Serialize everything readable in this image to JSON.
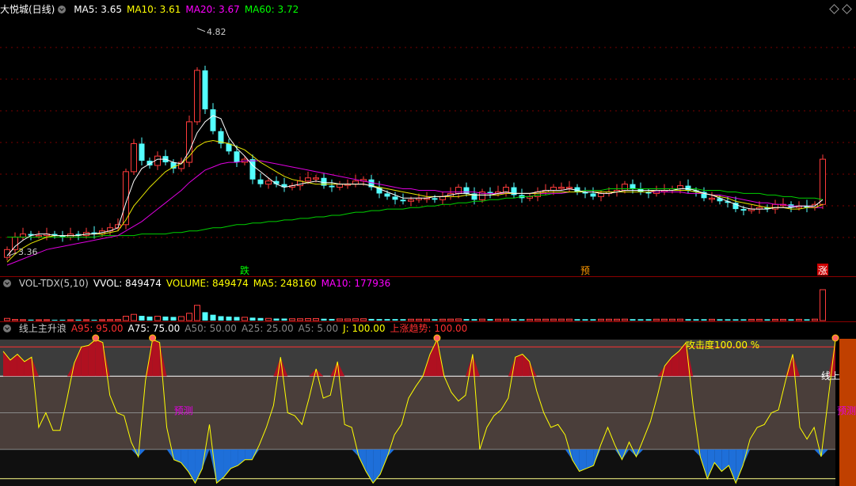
{
  "price_panel": {
    "title": "大悦城(日线)",
    "ma_items": [
      {
        "label": "MA5: 3.65",
        "color": "#ffffff"
      },
      {
        "label": "MA10: 3.61",
        "color": "#ffff00"
      },
      {
        "label": "MA20: 3.67",
        "color": "#ff00ff"
      },
      {
        "label": "MA60: 3.72",
        "color": "#00ff00"
      }
    ],
    "high_label": "4.82",
    "low_label": "3.36",
    "signals": [
      {
        "text": "跌",
        "color": "#00ff00"
      },
      {
        "text": "预",
        "color": "#ff9900"
      },
      {
        "text": "涨",
        "color": "#ffffff",
        "bg": "#cc0000"
      }
    ]
  },
  "volume_panel": {
    "items": [
      {
        "label": "VOL-TDX(5,10)",
        "color": "#cccccc"
      },
      {
        "label": "VVOL: 849474",
        "color": "#ffffff"
      },
      {
        "label": "VOLUME: 849474",
        "color": "#ffff00"
      },
      {
        "label": "MA5: 248160",
        "color": "#ffff00"
      },
      {
        "label": "MA10: 177936",
        "color": "#ff00ff"
      }
    ]
  },
  "indicator_panel": {
    "items": [
      {
        "label": "线上主升浪",
        "color": "#cccccc"
      },
      {
        "label": "A95: 95.00",
        "color": "#ff3030"
      },
      {
        "label": "A75: 75.00",
        "color": "#ffffff"
      },
      {
        "label": "A50: 50.00",
        "color": "#888888"
      },
      {
        "label": "A25: 25.00",
        "color": "#888888"
      },
      {
        "label": "A5: 5.00",
        "color": "#888888"
      },
      {
        "label": "J: 100.00",
        "color": "#ffff00"
      },
      {
        "label": "上涨趋势: 100.00",
        "color": "#ff3030"
      }
    ],
    "attack_label": "攻击度100.00 %",
    "side_label": "线上",
    "predict_label": "预测"
  },
  "chart_data": [
    {
      "type": "candlestick",
      "title": "大悦城(日线)",
      "annotations": {
        "max": 4.82,
        "min": 3.36
      },
      "ylim": [
        3.3,
        4.9
      ],
      "closes": [
        3.4,
        3.48,
        3.5,
        3.49,
        3.49,
        3.5,
        3.49,
        3.48,
        3.5,
        3.49,
        3.51,
        3.5,
        3.52,
        3.54,
        3.56,
        3.9,
        4.08,
        3.97,
        3.94,
        4.0,
        3.96,
        3.92,
        3.96,
        4.22,
        4.55,
        4.3,
        4.16,
        4.08,
        4.03,
        3.96,
        3.98,
        3.85,
        3.82,
        3.84,
        3.82,
        3.8,
        3.81,
        3.84,
        3.86,
        3.86,
        3.81,
        3.8,
        3.82,
        3.82,
        3.84,
        3.85,
        3.8,
        3.76,
        3.74,
        3.72,
        3.71,
        3.72,
        3.73,
        3.73,
        3.72,
        3.74,
        3.76,
        3.8,
        3.76,
        3.72,
        3.77,
        3.76,
        3.77,
        3.8,
        3.75,
        3.73,
        3.74,
        3.77,
        3.78,
        3.8,
        3.8,
        3.8,
        3.77,
        3.76,
        3.74,
        3.76,
        3.77,
        3.78,
        3.82,
        3.79,
        3.77,
        3.76,
        3.78,
        3.78,
        3.79,
        3.81,
        3.78,
        3.77,
        3.73,
        3.73,
        3.71,
        3.7,
        3.66,
        3.65,
        3.66,
        3.67,
        3.66,
        3.69,
        3.69,
        3.67,
        3.68,
        3.67,
        3.69,
        3.98
      ],
      "ma5": [
        3.36,
        3.42,
        3.46,
        3.49,
        3.5,
        3.5,
        3.49,
        3.49,
        3.49,
        3.49,
        3.5,
        3.5,
        3.51,
        3.52,
        3.54,
        3.7,
        3.84,
        3.92,
        3.95,
        3.98,
        3.98,
        3.96,
        3.95,
        4.03,
        4.15,
        4.22,
        4.26,
        4.24,
        4.12,
        4.05,
        4.0,
        3.94,
        3.9,
        3.86,
        3.82,
        3.8,
        3.81,
        3.82,
        3.83,
        3.84,
        3.83,
        3.83,
        3.82,
        3.82,
        3.82,
        3.82,
        3.81,
        3.79,
        3.77,
        3.75,
        3.73,
        3.73,
        3.73,
        3.73,
        3.74,
        3.74,
        3.75,
        3.76,
        3.76,
        3.75,
        3.75,
        3.75,
        3.76,
        3.77,
        3.76,
        3.76,
        3.76,
        3.77,
        3.78,
        3.78,
        3.78,
        3.79,
        3.78,
        3.77,
        3.77,
        3.76,
        3.76,
        3.77,
        3.78,
        3.78,
        3.78,
        3.78,
        3.78,
        3.78,
        3.78,
        3.79,
        3.79,
        3.78,
        3.76,
        3.75,
        3.73,
        3.71,
        3.69,
        3.67,
        3.66,
        3.66,
        3.66,
        3.67,
        3.67,
        3.67,
        3.68,
        3.68,
        3.68,
        3.72
      ],
      "ma10": [
        3.32,
        3.37,
        3.41,
        3.44,
        3.46,
        3.48,
        3.49,
        3.49,
        3.49,
        3.49,
        3.5,
        3.5,
        3.5,
        3.51,
        3.52,
        3.59,
        3.68,
        3.74,
        3.8,
        3.85,
        3.9,
        3.93,
        3.95,
        4.0,
        4.06,
        4.09,
        4.1,
        4.09,
        4.08,
        4.06,
        4.04,
        4.0,
        3.96,
        3.93,
        3.9,
        3.87,
        3.85,
        3.84,
        3.83,
        3.82,
        3.82,
        3.82,
        3.82,
        3.82,
        3.82,
        3.82,
        3.81,
        3.8,
        3.79,
        3.78,
        3.77,
        3.76,
        3.75,
        3.74,
        3.74,
        3.74,
        3.74,
        3.74,
        3.75,
        3.75,
        3.75,
        3.75,
        3.75,
        3.76,
        3.76,
        3.76,
        3.76,
        3.76,
        3.77,
        3.77,
        3.77,
        3.77,
        3.77,
        3.77,
        3.77,
        3.77,
        3.77,
        3.77,
        3.77,
        3.77,
        3.77,
        3.77,
        3.78,
        3.78,
        3.78,
        3.78,
        3.78,
        3.77,
        3.76,
        3.75,
        3.74,
        3.73,
        3.71,
        3.7,
        3.69,
        3.68,
        3.67,
        3.67,
        3.67,
        3.66,
        3.66,
        3.67,
        3.67,
        3.69
      ],
      "ma20": [
        3.3,
        3.32,
        3.34,
        3.36,
        3.38,
        3.4,
        3.41,
        3.42,
        3.43,
        3.44,
        3.45,
        3.46,
        3.47,
        3.48,
        3.49,
        3.52,
        3.55,
        3.58,
        3.62,
        3.66,
        3.7,
        3.74,
        3.78,
        3.83,
        3.87,
        3.91,
        3.93,
        3.95,
        3.96,
        3.96,
        3.97,
        3.97,
        3.97,
        3.96,
        3.95,
        3.94,
        3.93,
        3.92,
        3.91,
        3.9,
        3.89,
        3.88,
        3.87,
        3.86,
        3.85,
        3.84,
        3.83,
        3.82,
        3.81,
        3.8,
        3.79,
        3.79,
        3.78,
        3.78,
        3.78,
        3.77,
        3.77,
        3.77,
        3.77,
        3.77,
        3.76,
        3.76,
        3.76,
        3.76,
        3.76,
        3.76,
        3.76,
        3.76,
        3.76,
        3.76,
        3.76,
        3.77,
        3.77,
        3.77,
        3.77,
        3.77,
        3.77,
        3.77,
        3.77,
        3.77,
        3.77,
        3.77,
        3.77,
        3.77,
        3.77,
        3.77,
        3.76,
        3.76,
        3.76,
        3.75,
        3.75,
        3.74,
        3.73,
        3.72,
        3.71,
        3.7,
        3.7,
        3.69,
        3.69,
        3.68,
        3.68,
        3.68,
        3.67,
        3.67
      ],
      "ma60": [
        3.48,
        3.48,
        3.48,
        3.48,
        3.48,
        3.48,
        3.48,
        3.48,
        3.48,
        3.48,
        3.48,
        3.48,
        3.49,
        3.49,
        3.49,
        3.49,
        3.49,
        3.5,
        3.5,
        3.5,
        3.5,
        3.51,
        3.51,
        3.52,
        3.52,
        3.53,
        3.54,
        3.54,
        3.55,
        3.56,
        3.56,
        3.57,
        3.57,
        3.58,
        3.58,
        3.59,
        3.59,
        3.6,
        3.6,
        3.61,
        3.61,
        3.62,
        3.62,
        3.63,
        3.64,
        3.64,
        3.65,
        3.65,
        3.66,
        3.66,
        3.66,
        3.67,
        3.67,
        3.68,
        3.68,
        3.69,
        3.69,
        3.7,
        3.7,
        3.71,
        3.71,
        3.72,
        3.72,
        3.73,
        3.73,
        3.74,
        3.74,
        3.75,
        3.75,
        3.76,
        3.76,
        3.77,
        3.77,
        3.78,
        3.78,
        3.78,
        3.79,
        3.79,
        3.79,
        3.79,
        3.79,
        3.79,
        3.79,
        3.79,
        3.79,
        3.79,
        3.79,
        3.79,
        3.78,
        3.78,
        3.78,
        3.77,
        3.77,
        3.76,
        3.76,
        3.76,
        3.75,
        3.75,
        3.74,
        3.74,
        3.73,
        3.73,
        3.73,
        3.72
      ]
    },
    {
      "type": "bar",
      "title": "VOL-TDX(5,10)",
      "values": [
        60,
        30,
        25,
        25,
        22,
        24,
        22,
        20,
        22,
        25,
        24,
        22,
        24,
        26,
        28,
        120,
        170,
        130,
        110,
        120,
        110,
        100,
        110,
        200,
        420,
        230,
        160,
        120,
        110,
        100,
        90,
        80,
        70,
        60,
        55,
        55,
        50,
        50,
        55,
        55,
        50,
        45,
        45,
        45,
        50,
        50,
        45,
        40,
        40,
        40,
        38,
        38,
        38,
        38,
        36,
        38,
        40,
        45,
        40,
        38,
        40,
        40,
        38,
        40,
        38,
        36,
        36,
        38,
        38,
        40,
        40,
        40,
        38,
        36,
        36,
        38,
        38,
        38,
        40,
        38,
        36,
        36,
        38,
        38,
        38,
        40,
        38,
        36,
        36,
        36,
        35,
        35,
        34,
        34,
        34,
        35,
        34,
        35,
        35,
        34,
        35,
        34,
        40,
        849
      ]
    },
    {
      "type": "line",
      "title": "线上主升浪",
      "reference_lines": [
        95,
        75,
        50,
        25,
        5
      ],
      "ylim": [
        0,
        100
      ],
      "j_values": [
        92,
        86,
        90,
        85,
        88,
        40,
        50,
        38,
        38,
        60,
        84,
        95,
        96,
        100,
        98,
        62,
        50,
        48,
        30,
        20,
        72,
        100,
        98,
        40,
        18,
        16,
        10,
        2,
        12,
        42,
        2,
        6,
        12,
        14,
        18,
        18,
        28,
        40,
        55,
        88,
        50,
        48,
        42,
        60,
        80,
        60,
        62,
        85,
        42,
        40,
        20,
        10,
        2,
        8,
        20,
        35,
        42,
        60,
        68,
        75,
        90,
        100,
        75,
        64,
        58,
        62,
        90,
        25,
        40,
        48,
        52,
        60,
        88,
        90,
        85,
        65,
        50,
        40,
        42,
        35,
        18,
        10,
        12,
        14,
        28,
        40,
        28,
        18,
        30,
        20,
        32,
        44,
        62,
        82,
        88,
        92,
        98,
        55,
        20,
        5,
        16,
        10,
        14,
        2,
        14,
        32,
        40,
        42,
        50,
        52,
        72,
        90,
        40,
        32,
        40,
        20,
        60,
        100
      ]
    }
  ]
}
